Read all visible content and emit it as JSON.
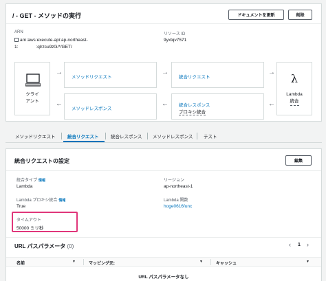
{
  "header": {
    "title": "/ - GET - メソッドの実行",
    "update_doc_button": "ドキュメントを更新",
    "delete_button": "削除"
  },
  "summary": {
    "arn_label": "ARN",
    "arn_value_line1": "arn:aws:execute-api:ap-northeast-",
    "arn_value_line2": "1:    :qlrzcu9z0i/*/GET/",
    "resource_id_label": "リソース ID",
    "resource_id_value": "9yxtqv7571"
  },
  "flow": {
    "client_label_1": "クライ",
    "client_label_2": "アント",
    "method_request": "メソッドリクエスト",
    "integration_request": "統合リクエスト",
    "method_response": "メソッドレスポンス",
    "integration_response": "統合レスポンス",
    "proxy_integration": "プロキシ統合",
    "lambda_label_1": "Lambda",
    "lambda_label_2": "統合"
  },
  "tabs": [
    {
      "label": "メソッドリクエスト"
    },
    {
      "label": "統合リクエスト"
    },
    {
      "label": "統合レスポンス"
    },
    {
      "label": "メソッドレスポンス"
    },
    {
      "label": "テスト"
    }
  ],
  "settings": {
    "title": "統合リクエストの設定",
    "edit_button": "編集",
    "integration_type_label": "統合タイプ",
    "info": "情報",
    "integration_type_value": "Lambda",
    "region_label": "リージョン",
    "region_value": "ap-northeast-1",
    "proxy_label": "Lambda プロキシ統合",
    "proxy_value": "True",
    "function_label": "Lambda 関数",
    "function_value": "hoge0616func",
    "timeout_label": "タイムアウト",
    "timeout_value": "50000 ミリ秒"
  },
  "url_params": {
    "title": "URL パスパラメータ",
    "count": "(0)",
    "page": "1",
    "col_name": "名前",
    "col_mapping": "マッピング元:",
    "col_cache": "キャッシュ",
    "empty": "URL パスパラメータなし"
  },
  "colors": {
    "link": "#0073bb",
    "active_tab": "#0073bb",
    "highlight_box": "#e0367a"
  }
}
